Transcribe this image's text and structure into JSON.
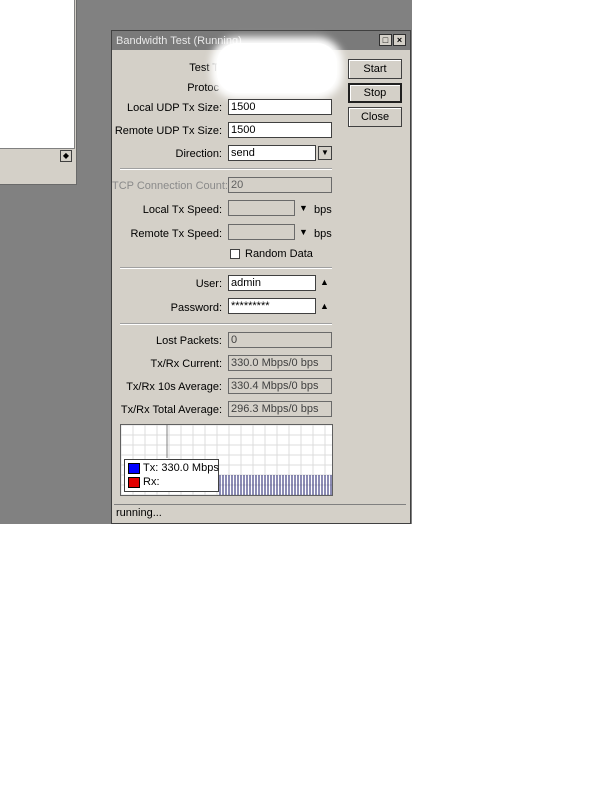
{
  "window": {
    "title": "Bandwidth Test (Running)",
    "maximize_symbol": "□",
    "close_symbol": "×"
  },
  "form": {
    "test_to_label": "Test T",
    "protocol_label": "Protoc",
    "local_udp_tx_size_label": "Local UDP Tx Size:",
    "local_udp_tx_size_value": "1500",
    "remote_udp_tx_size_label": "Remote UDP Tx Size:",
    "remote_udp_tx_size_value": "1500",
    "direction_label": "Direction:",
    "direction_value": "send",
    "tcp_connection_count_label": "TCP Connection Count:",
    "tcp_connection_count_value": "20",
    "local_tx_speed_label": "Local Tx Speed:",
    "local_tx_speed_value": "",
    "local_tx_speed_unit": "bps",
    "remote_tx_speed_label": "Remote Tx Speed:",
    "remote_tx_speed_value": "",
    "remote_tx_speed_unit": "bps",
    "random_data_label": "Random Data",
    "random_data_checked": false,
    "user_label": "User:",
    "user_value": "admin",
    "password_label": "Password:",
    "password_value": "*********"
  },
  "stats": {
    "lost_packets_label": "Lost Packets:",
    "lost_packets_value": "0",
    "current_label": "Tx/Rx Current:",
    "current_value": "330.0 Mbps/0 bps",
    "avg10_label": "Tx/Rx 10s Average:",
    "avg10_value": "330.4 Mbps/0 bps",
    "total_avg_label": "Tx/Rx Total Average:",
    "total_avg_value": "296.3 Mbps/0 bps"
  },
  "buttons": {
    "start": "Start",
    "stop": "Stop",
    "close": "Close"
  },
  "graph": {
    "legend_tx": "Tx:  330.0 Mbps",
    "legend_rx": "Rx:",
    "tx_color": "#0000ff",
    "rx_color": "#e00000"
  },
  "status": "running..."
}
